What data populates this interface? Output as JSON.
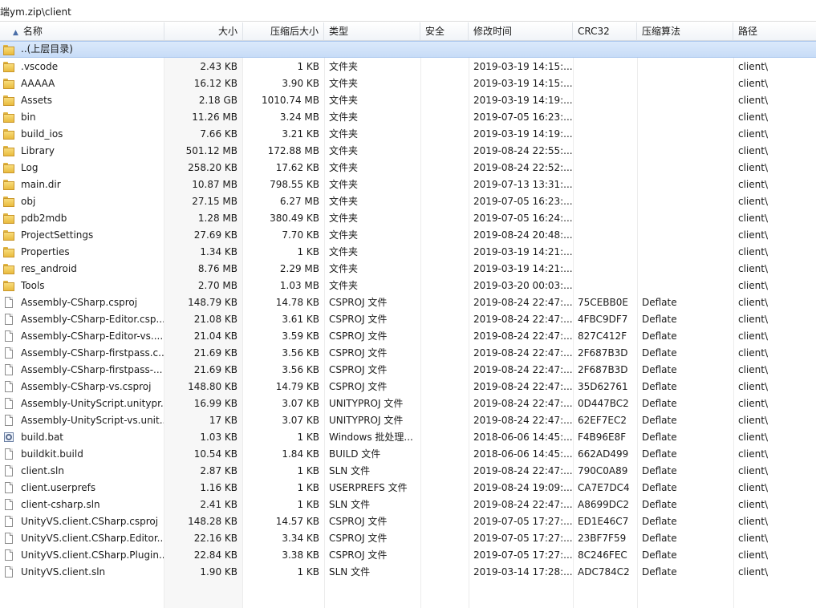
{
  "window": {
    "path": "端ym.zip\\client"
  },
  "columns": {
    "name": "名称",
    "size": "大小",
    "compressed": "压缩后大小",
    "type": "类型",
    "security": "安全",
    "modified": "修改时间",
    "crc": "CRC32",
    "algorithm": "压缩算法",
    "path": "路径"
  },
  "parent_row": {
    "name": "..(上层目录)"
  },
  "rows": [
    {
      "icon": "folder-icon",
      "name": ".vscode",
      "size": "2.43 KB",
      "compressed": "1 KB",
      "type": "文件夹",
      "modified": "2019-03-19 14:15:...",
      "crc": "",
      "algorithm": "",
      "path": "client\\"
    },
    {
      "icon": "folder-icon",
      "name": "AAAAA",
      "size": "16.12 KB",
      "compressed": "3.90 KB",
      "type": "文件夹",
      "modified": "2019-03-19 14:15:...",
      "crc": "",
      "algorithm": "",
      "path": "client\\"
    },
    {
      "icon": "folder-icon",
      "name": "Assets",
      "size": "2.18 GB",
      "compressed": "1010.74 MB",
      "type": "文件夹",
      "modified": "2019-03-19 14:19:...",
      "crc": "",
      "algorithm": "",
      "path": "client\\"
    },
    {
      "icon": "folder-icon",
      "name": "bin",
      "size": "11.26 MB",
      "compressed": "3.24 MB",
      "type": "文件夹",
      "modified": "2019-07-05 16:23:...",
      "crc": "",
      "algorithm": "",
      "path": "client\\"
    },
    {
      "icon": "folder-icon",
      "name": "build_ios",
      "size": "7.66 KB",
      "compressed": "3.21 KB",
      "type": "文件夹",
      "modified": "2019-03-19 14:19:...",
      "crc": "",
      "algorithm": "",
      "path": "client\\"
    },
    {
      "icon": "folder-icon",
      "name": "Library",
      "size": "501.12 MB",
      "compressed": "172.88 MB",
      "type": "文件夹",
      "modified": "2019-08-24 22:55:...",
      "crc": "",
      "algorithm": "",
      "path": "client\\"
    },
    {
      "icon": "folder-icon",
      "name": "Log",
      "size": "258.20 KB",
      "compressed": "17.62 KB",
      "type": "文件夹",
      "modified": "2019-08-24 22:52:...",
      "crc": "",
      "algorithm": "",
      "path": "client\\"
    },
    {
      "icon": "folder-icon",
      "name": "main.dir",
      "size": "10.87 MB",
      "compressed": "798.55 KB",
      "type": "文件夹",
      "modified": "2019-07-13 13:31:...",
      "crc": "",
      "algorithm": "",
      "path": "client\\"
    },
    {
      "icon": "folder-icon",
      "name": "obj",
      "size": "27.15 MB",
      "compressed": "6.27 MB",
      "type": "文件夹",
      "modified": "2019-07-05 16:23:...",
      "crc": "",
      "algorithm": "",
      "path": "client\\"
    },
    {
      "icon": "folder-icon",
      "name": "pdb2mdb",
      "size": "1.28 MB",
      "compressed": "380.49 KB",
      "type": "文件夹",
      "modified": "2019-07-05 16:24:...",
      "crc": "",
      "algorithm": "",
      "path": "client\\"
    },
    {
      "icon": "folder-icon",
      "name": "ProjectSettings",
      "size": "27.69 KB",
      "compressed": "7.70 KB",
      "type": "文件夹",
      "modified": "2019-08-24 20:48:...",
      "crc": "",
      "algorithm": "",
      "path": "client\\"
    },
    {
      "icon": "folder-icon",
      "name": "Properties",
      "size": "1.34 KB",
      "compressed": "1 KB",
      "type": "文件夹",
      "modified": "2019-03-19 14:21:...",
      "crc": "",
      "algorithm": "",
      "path": "client\\"
    },
    {
      "icon": "folder-icon",
      "name": "res_android",
      "size": "8.76 MB",
      "compressed": "2.29 MB",
      "type": "文件夹",
      "modified": "2019-03-19 14:21:...",
      "crc": "",
      "algorithm": "",
      "path": "client\\"
    },
    {
      "icon": "folder-icon",
      "name": "Tools",
      "size": "2.70 MB",
      "compressed": "1.03 MB",
      "type": "文件夹",
      "modified": "2019-03-20 00:03:...",
      "crc": "",
      "algorithm": "",
      "path": "client\\"
    },
    {
      "icon": "file-icon",
      "name": "Assembly-CSharp.csproj",
      "size": "148.79 KB",
      "compressed": "14.78 KB",
      "type": "CSPROJ 文件",
      "modified": "2019-08-24 22:47:...",
      "crc": "75CEBB0E",
      "algorithm": "Deflate",
      "path": "client\\"
    },
    {
      "icon": "file-icon",
      "name": "Assembly-CSharp-Editor.csp...",
      "size": "21.08 KB",
      "compressed": "3.61 KB",
      "type": "CSPROJ 文件",
      "modified": "2019-08-24 22:47:...",
      "crc": "4FBC9DF7",
      "algorithm": "Deflate",
      "path": "client\\"
    },
    {
      "icon": "file-icon",
      "name": "Assembly-CSharp-Editor-vs....",
      "size": "21.04 KB",
      "compressed": "3.59 KB",
      "type": "CSPROJ 文件",
      "modified": "2019-08-24 22:47:...",
      "crc": "827C412F",
      "algorithm": "Deflate",
      "path": "client\\"
    },
    {
      "icon": "file-icon",
      "name": "Assembly-CSharp-firstpass.c...",
      "size": "21.69 KB",
      "compressed": "3.56 KB",
      "type": "CSPROJ 文件",
      "modified": "2019-08-24 22:47:...",
      "crc": "2F687B3D",
      "algorithm": "Deflate",
      "path": "client\\"
    },
    {
      "icon": "file-icon",
      "name": "Assembly-CSharp-firstpass-...",
      "size": "21.69 KB",
      "compressed": "3.56 KB",
      "type": "CSPROJ 文件",
      "modified": "2019-08-24 22:47:...",
      "crc": "2F687B3D",
      "algorithm": "Deflate",
      "path": "client\\"
    },
    {
      "icon": "file-icon",
      "name": "Assembly-CSharp-vs.csproj",
      "size": "148.80 KB",
      "compressed": "14.79 KB",
      "type": "CSPROJ 文件",
      "modified": "2019-08-24 22:47:...",
      "crc": "35D62761",
      "algorithm": "Deflate",
      "path": "client\\"
    },
    {
      "icon": "file-icon",
      "name": "Assembly-UnityScript.unitypr...",
      "size": "16.99 KB",
      "compressed": "3.07 KB",
      "type": "UNITYPROJ 文件",
      "modified": "2019-08-24 22:47:...",
      "crc": "0D447BC2",
      "algorithm": "Deflate",
      "path": "client\\"
    },
    {
      "icon": "file-icon",
      "name": "Assembly-UnityScript-vs.unit...",
      "size": "17 KB",
      "compressed": "3.07 KB",
      "type": "UNITYPROJ 文件",
      "modified": "2019-08-24 22:47:...",
      "crc": "62EF7EC2",
      "algorithm": "Deflate",
      "path": "client\\"
    },
    {
      "icon": "bat-icon",
      "name": "build.bat",
      "size": "1.03 KB",
      "compressed": "1 KB",
      "type": "Windows 批处理...",
      "modified": "2018-06-06 14:45:...",
      "crc": "F4B96E8F",
      "algorithm": "Deflate",
      "path": "client\\"
    },
    {
      "icon": "file-icon",
      "name": "buildkit.build",
      "size": "10.54 KB",
      "compressed": "1.84 KB",
      "type": "BUILD 文件",
      "modified": "2018-06-06 14:45:...",
      "crc": "662AD499",
      "algorithm": "Deflate",
      "path": "client\\"
    },
    {
      "icon": "file-icon",
      "name": "client.sln",
      "size": "2.87 KB",
      "compressed": "1 KB",
      "type": "SLN 文件",
      "modified": "2019-08-24 22:47:...",
      "crc": "790C0A89",
      "algorithm": "Deflate",
      "path": "client\\"
    },
    {
      "icon": "file-icon",
      "name": "client.userprefs",
      "size": "1.16 KB",
      "compressed": "1 KB",
      "type": "USERPREFS 文件",
      "modified": "2019-08-24 19:09:...",
      "crc": "CA7E7DC4",
      "algorithm": "Deflate",
      "path": "client\\"
    },
    {
      "icon": "file-icon",
      "name": "client-csharp.sln",
      "size": "2.41 KB",
      "compressed": "1 KB",
      "type": "SLN 文件",
      "modified": "2019-08-24 22:47:...",
      "crc": "A8699DC2",
      "algorithm": "Deflate",
      "path": "client\\"
    },
    {
      "icon": "file-icon",
      "name": "UnityVS.client.CSharp.csproj",
      "size": "148.28 KB",
      "compressed": "14.57 KB",
      "type": "CSPROJ 文件",
      "modified": "2019-07-05 17:27:...",
      "crc": "ED1E46C7",
      "algorithm": "Deflate",
      "path": "client\\"
    },
    {
      "icon": "file-icon",
      "name": "UnityVS.client.CSharp.Editor....",
      "size": "22.16 KB",
      "compressed": "3.34 KB",
      "type": "CSPROJ 文件",
      "modified": "2019-07-05 17:27:...",
      "crc": "23BF7F59",
      "algorithm": "Deflate",
      "path": "client\\"
    },
    {
      "icon": "file-icon",
      "name": "UnityVS.client.CSharp.Plugin...",
      "size": "22.84 KB",
      "compressed": "3.38 KB",
      "type": "CSPROJ 文件",
      "modified": "2019-07-05 17:27:...",
      "crc": "8C246FEC",
      "algorithm": "Deflate",
      "path": "client\\"
    },
    {
      "icon": "file-icon",
      "name": "UnityVS.client.sln",
      "size": "1.90 KB",
      "compressed": "1 KB",
      "type": "SLN 文件",
      "modified": "2019-03-14 17:28:...",
      "crc": "ADC784C2",
      "algorithm": "Deflate",
      "path": "client\\"
    }
  ]
}
